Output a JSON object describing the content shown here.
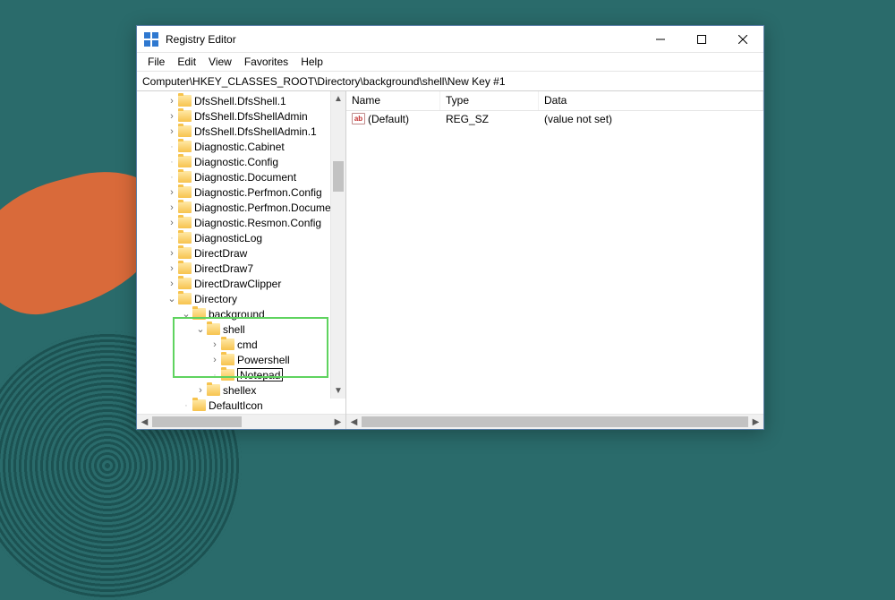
{
  "window": {
    "title": "Registry Editor"
  },
  "menu": {
    "file": "File",
    "edit": "Edit",
    "view": "View",
    "favorites": "Favorites",
    "help": "Help"
  },
  "address": {
    "path": "Computer\\HKEY_CLASSES_ROOT\\Directory\\background\\shell\\New Key #1"
  },
  "tree": {
    "items": [
      {
        "label": "DfsShell.DfsShell.1",
        "indent": 2,
        "chevron": ">"
      },
      {
        "label": "DfsShell.DfsShellAdmin",
        "indent": 2,
        "chevron": ">"
      },
      {
        "label": "DfsShell.DfsShellAdmin.1",
        "indent": 2,
        "chevron": ">"
      },
      {
        "label": "Diagnostic.Cabinet",
        "indent": 2,
        "chevron": ""
      },
      {
        "label": "Diagnostic.Config",
        "indent": 2,
        "chevron": ""
      },
      {
        "label": "Diagnostic.Document",
        "indent": 2,
        "chevron": ""
      },
      {
        "label": "Diagnostic.Perfmon.Config",
        "indent": 2,
        "chevron": ">"
      },
      {
        "label": "Diagnostic.Perfmon.Document",
        "indent": 2,
        "chevron": ">"
      },
      {
        "label": "Diagnostic.Resmon.Config",
        "indent": 2,
        "chevron": ">"
      },
      {
        "label": "DiagnosticLog",
        "indent": 2,
        "chevron": ""
      },
      {
        "label": "DirectDraw",
        "indent": 2,
        "chevron": ">"
      },
      {
        "label": "DirectDraw7",
        "indent": 2,
        "chevron": ">"
      },
      {
        "label": "DirectDrawClipper",
        "indent": 2,
        "chevron": ">"
      },
      {
        "label": "Directory",
        "indent": 2,
        "chevron": "v"
      },
      {
        "label": "background",
        "indent": 3,
        "chevron": "v"
      },
      {
        "label": "shell",
        "indent": 4,
        "chevron": "v"
      },
      {
        "label": "cmd",
        "indent": 5,
        "chevron": ">"
      },
      {
        "label": "Powershell",
        "indent": 5,
        "chevron": ">"
      },
      {
        "label": "Notepad",
        "indent": 5,
        "chevron": "",
        "editing": true
      },
      {
        "label": "shellex",
        "indent": 4,
        "chevron": ">"
      },
      {
        "label": "DefaultIcon",
        "indent": 3,
        "chevron": ""
      }
    ]
  },
  "list": {
    "headers": {
      "name": "Name",
      "type": "Type",
      "data": "Data"
    },
    "rows": [
      {
        "name": "(Default)",
        "type": "REG_SZ",
        "data": "(value not set)"
      }
    ]
  }
}
